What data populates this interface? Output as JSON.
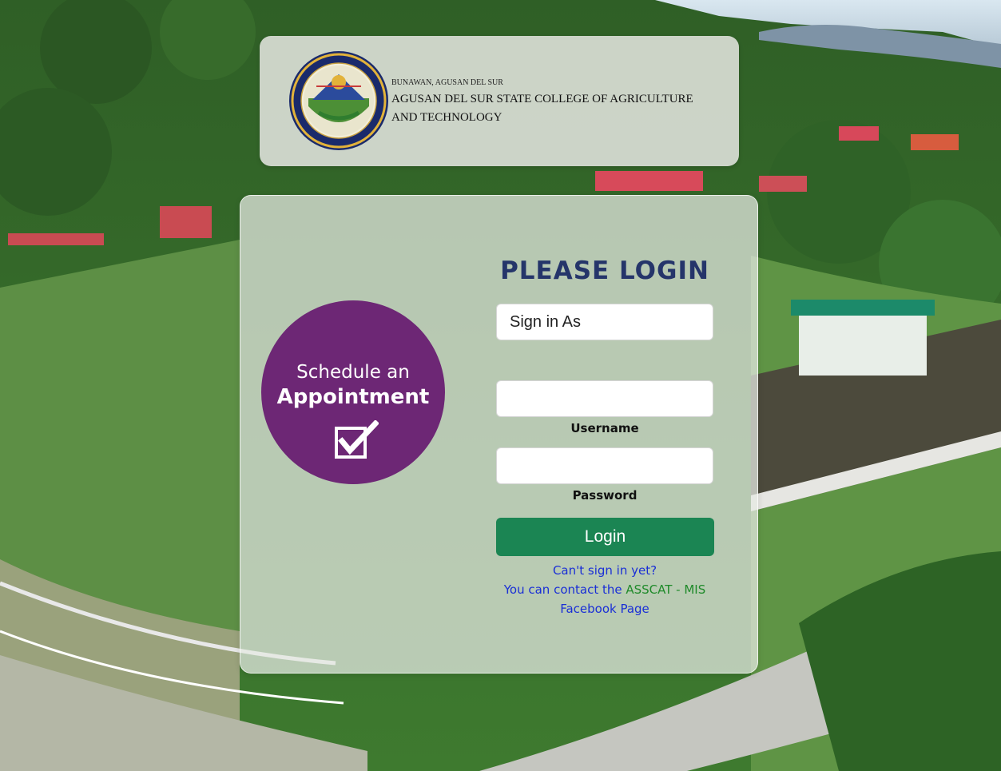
{
  "header": {
    "location": "BUNAWAN, AGUSAN DEL SUR",
    "college_name": "AGUSAN DEL SUR STATE COLLEGE OF AGRICULTURE AND TECHNOLOGY"
  },
  "appointment": {
    "line1": "Schedule an",
    "line2": "Appointment",
    "icon": "checkbox-checked-icon",
    "color": "#6d2775"
  },
  "login": {
    "title": "PLEASE LOGIN",
    "sign_in_as": {
      "placeholder": "Sign in As",
      "selected": "Sign in As"
    },
    "username_label": "Username",
    "username_value": "",
    "password_label": "Password",
    "password_value": "",
    "button_label": "Login",
    "button_color": "#1b8553",
    "help_line1": "Can't sign in yet?",
    "help_prefix": "You can contact the",
    "help_link": "ASSCAT - MIS",
    "help_page": "Facebook Page"
  }
}
